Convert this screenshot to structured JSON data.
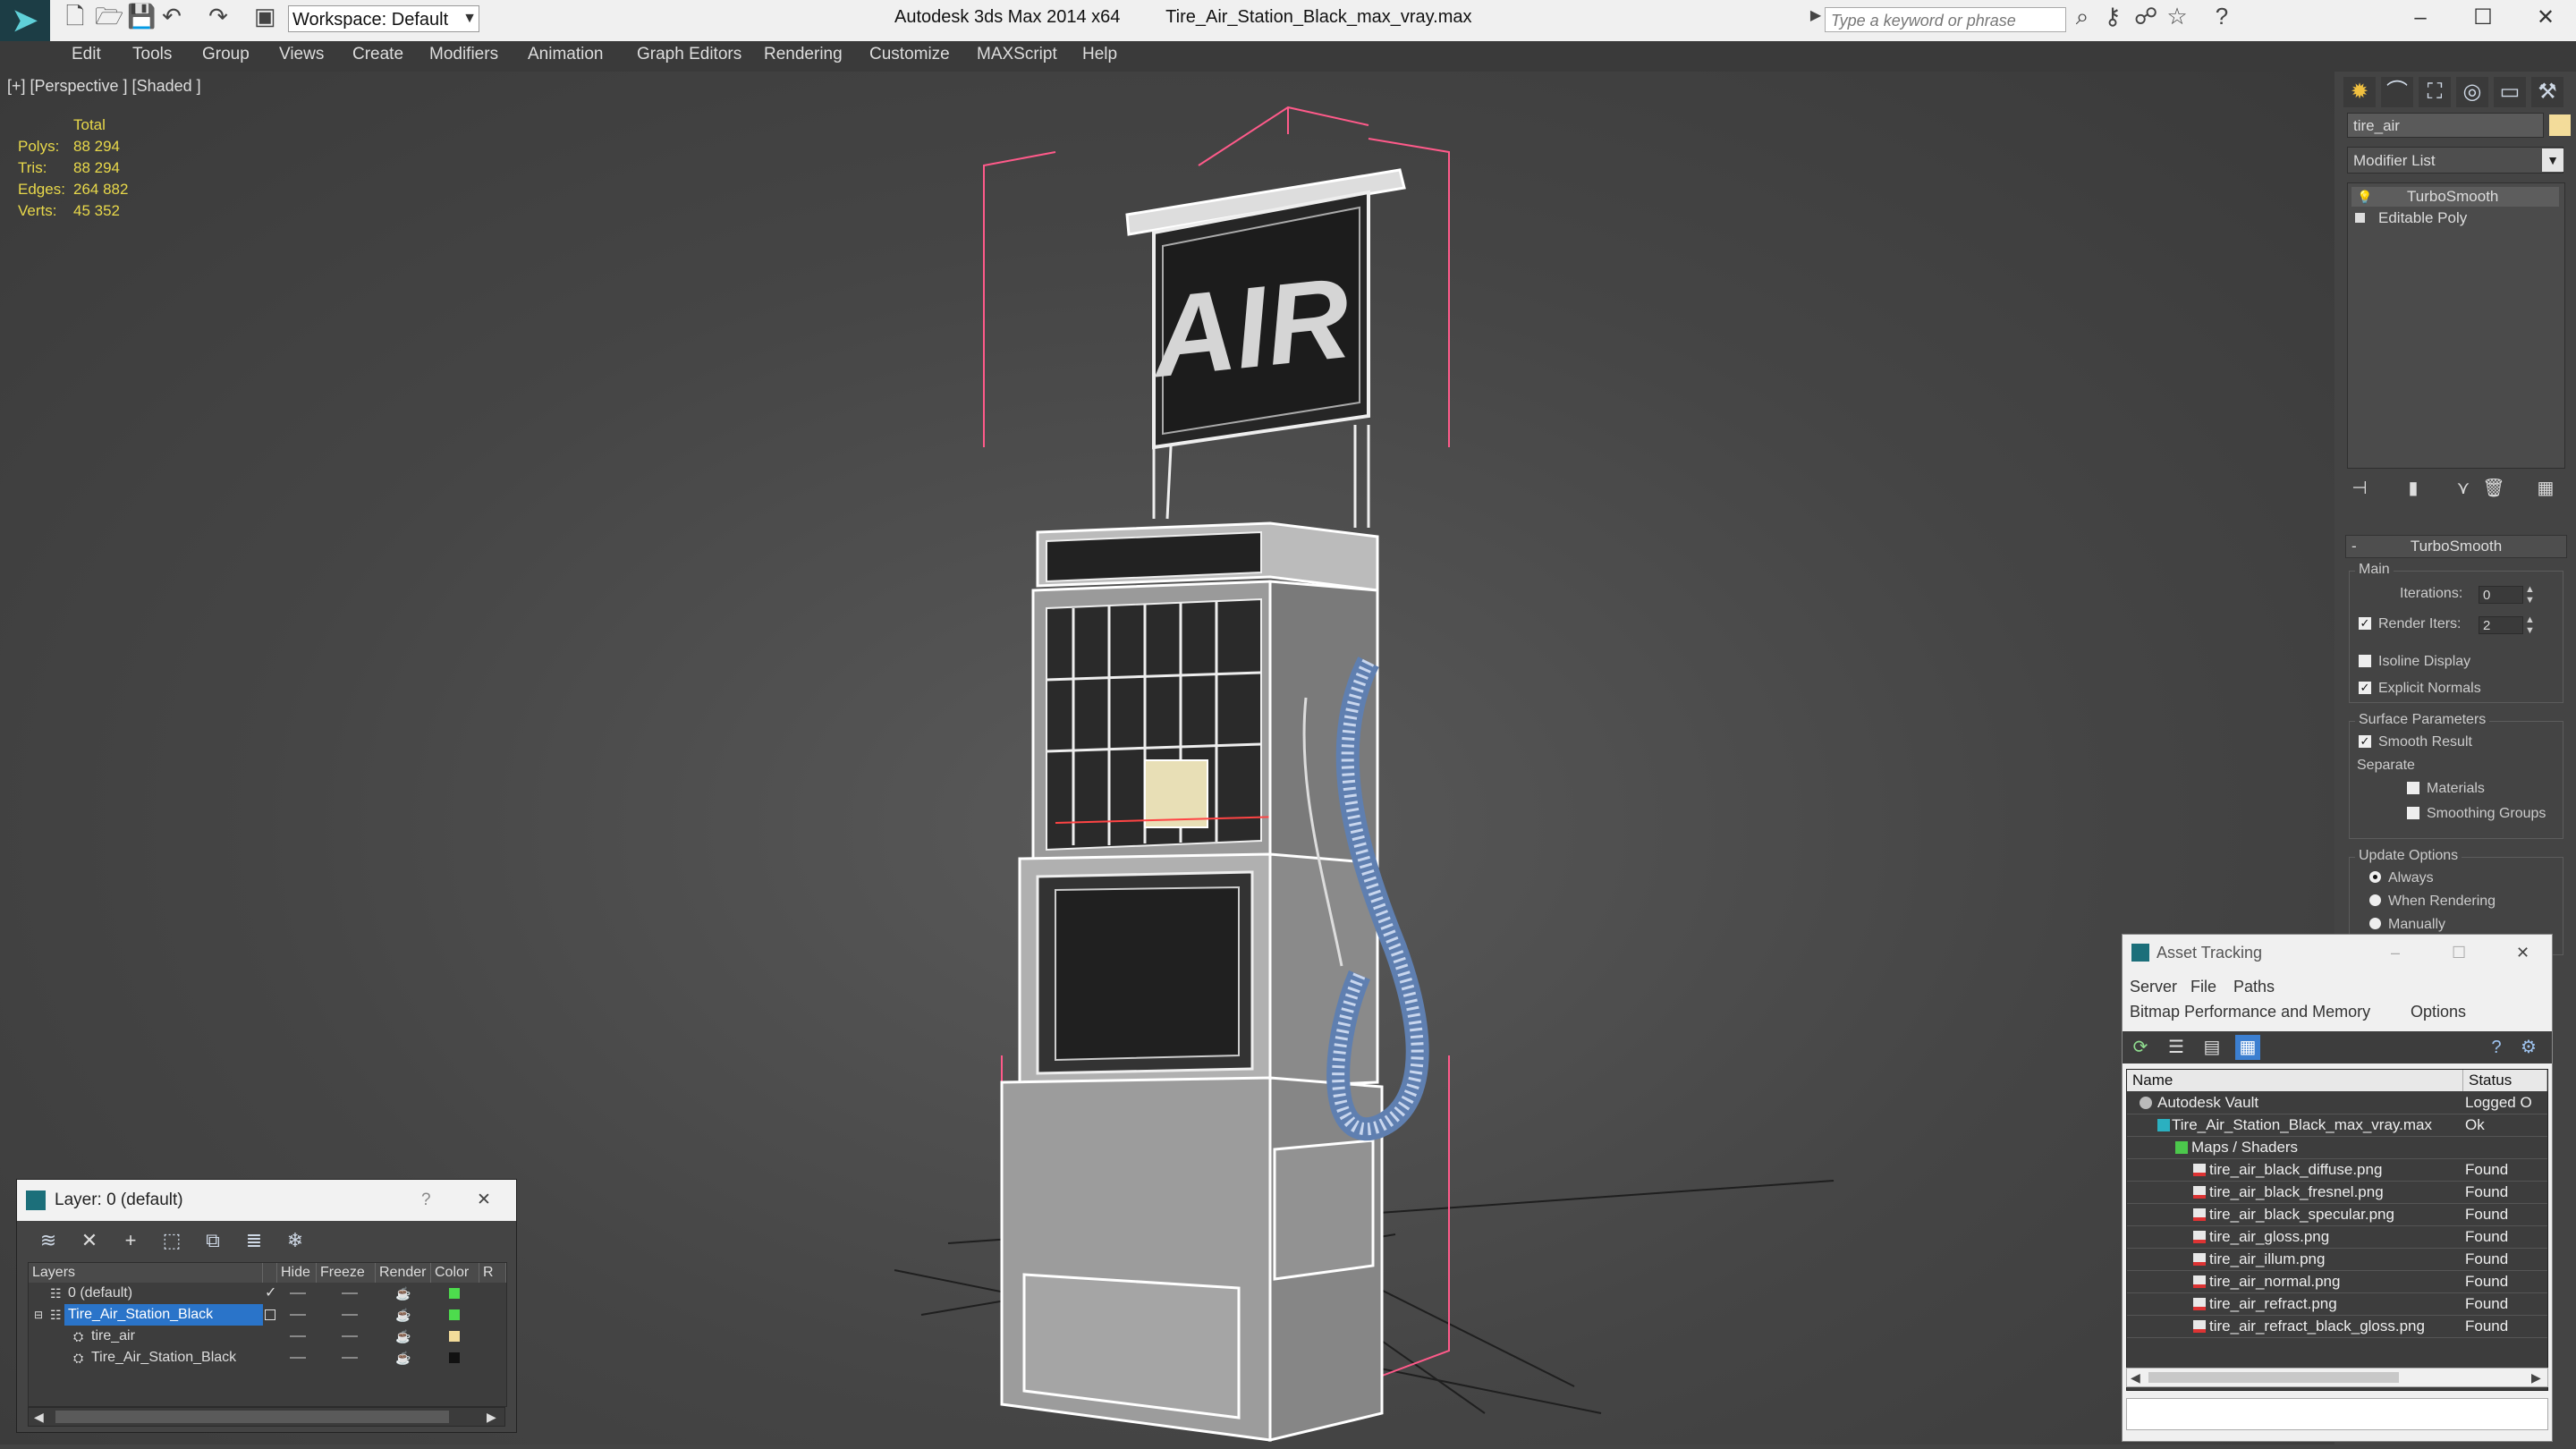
{
  "titlebar": {
    "workspace": "Workspace: Default",
    "app_title": "Autodesk 3ds Max  2014 x64",
    "file_title": "Tire_Air_Station_Black_max_vray.max",
    "search_placeholder": "Type a keyword or phrase",
    "minimize": "–",
    "maximize": "☐",
    "close": "✕"
  },
  "menu": [
    "Edit",
    "Tools",
    "Group",
    "Views",
    "Create",
    "Modifiers",
    "Animation",
    "Graph Editors",
    "Rendering",
    "Customize",
    "MAXScript",
    "Help"
  ],
  "viewport": {
    "label": "[+] [Perspective ] [Shaded ]",
    "sign_text": "AIR",
    "stats": {
      "header": "Total",
      "polys_label": "Polys:",
      "polys": "88 294",
      "tris_label": "Tris:",
      "tris": "88 294",
      "edges_label": "Edges:",
      "edges": "264 882",
      "verts_label": "Verts:",
      "verts": "45 352"
    }
  },
  "command_panel": {
    "object_name": "tire_air",
    "object_color": "#f3dc9a",
    "modifier_list": "Modifier List",
    "stack": [
      "TurboSmooth",
      "Editable Poly"
    ],
    "rollout_title": "TurboSmooth",
    "main_group": "Main",
    "iterations_label": "Iterations:",
    "iterations": "0",
    "render_iters_label": "Render Iters:",
    "render_iters": "2",
    "isoline_display": "Isoline Display",
    "explicit_normals": "Explicit Normals",
    "surface_group": "Surface Parameters",
    "smooth_result": "Smooth Result",
    "separate_label": "Separate",
    "materials": "Materials",
    "smoothing_groups": "Smoothing Groups",
    "update_group": "Update Options",
    "always": "Always",
    "when_rendering": "When Rendering",
    "manually": "Manually"
  },
  "layer_dialog": {
    "title": "Layer: 0 (default)",
    "help": "?",
    "close": "✕",
    "columns": [
      "Layers",
      "Hide",
      "Freeze",
      "Render",
      "Color",
      "R"
    ],
    "rows": [
      {
        "name": "0 (default)",
        "color": "#4ddc4d"
      },
      {
        "name": "Tire_Air_Station_Black",
        "color": "#4ddc4d"
      },
      {
        "name": "tire_air",
        "color": "#f3dc9a"
      },
      {
        "name": "Tire_Air_Station_Black",
        "color": "#111111"
      }
    ]
  },
  "asset_tracking": {
    "title": "Asset Tracking",
    "menu": [
      "Server",
      "File",
      "Paths",
      "Bitmap Performance and Memory",
      "Options"
    ],
    "columns": [
      "Name",
      "Status"
    ],
    "rows": [
      {
        "name": "Autodesk Vault",
        "status": "Logged O"
      },
      {
        "name": "Tire_Air_Station_Black_max_vray.max",
        "status": "Ok"
      },
      {
        "name": "Maps / Shaders",
        "status": ""
      },
      {
        "name": "tire_air_black_diffuse.png",
        "status": "Found"
      },
      {
        "name": "tire_air_black_fresnel.png",
        "status": "Found"
      },
      {
        "name": "tire_air_black_specular.png",
        "status": "Found"
      },
      {
        "name": "tire_air_gloss.png",
        "status": "Found"
      },
      {
        "name": "tire_air_illum.png",
        "status": "Found"
      },
      {
        "name": "tire_air_normal.png",
        "status": "Found"
      },
      {
        "name": "tire_air_refract.png",
        "status": "Found"
      },
      {
        "name": "tire_air_refract_black_gloss.png",
        "status": "Found"
      }
    ]
  }
}
